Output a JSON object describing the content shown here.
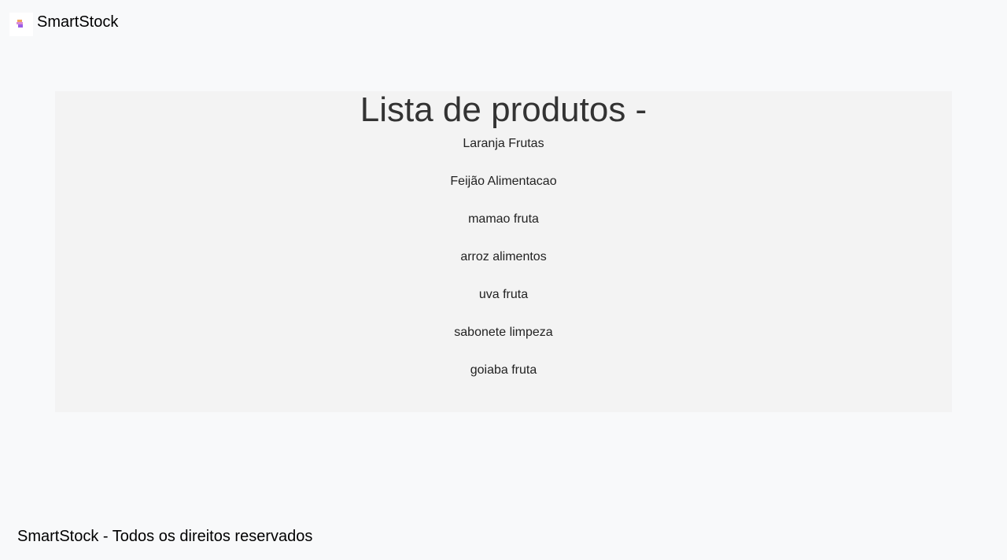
{
  "header": {
    "brand": "SmartStock",
    "logo_icon": "stacked-boxes-icon"
  },
  "main": {
    "title": "Lista de produtos -",
    "products": [
      "Laranja Frutas",
      "Feijão Alimentacao",
      "mamao fruta",
      "arroz alimentos",
      "uva fruta",
      "sabonete limpeza",
      "goiaba fruta"
    ]
  },
  "footer": {
    "text": "SmartStock - Todos os direitos reservados"
  }
}
